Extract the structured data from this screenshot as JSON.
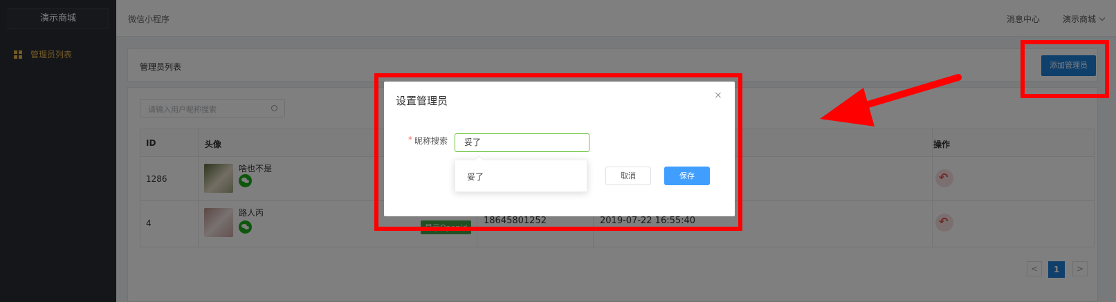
{
  "sidebar": {
    "brand": "演示商城",
    "menu_item": "管理员列表",
    "colors": {
      "bg": "#2a2c34",
      "active": "#e8b74b"
    }
  },
  "topbar": {
    "breadcrumb": "微信小程序",
    "message_center": "消息中心",
    "shop_name": "演示商城"
  },
  "panel": {
    "title": "管理员列表",
    "add_button": "添加管理员",
    "search_placeholder": "请输入用户昵称搜索"
  },
  "table": {
    "headers": [
      "ID",
      "头像",
      "操作"
    ],
    "rows": [
      {
        "id": "1286",
        "nickname": "啥也不是"
      },
      {
        "id": "4",
        "nickname": "路人丙",
        "openid_button": "显示Openid",
        "phone": "18645801252",
        "time": "2019-07-22 16:55:40"
      }
    ]
  },
  "pagination": {
    "prev": "<",
    "current": "1",
    "next": ">"
  },
  "modal": {
    "title": "设置管理员",
    "close": "×",
    "required_mark": "*",
    "field_label": "昵称搜索",
    "field_value": "妥了",
    "suggestion": "妥了",
    "cancel": "取消",
    "save": "保存"
  },
  "annotations": {
    "color": "#ff0000"
  }
}
